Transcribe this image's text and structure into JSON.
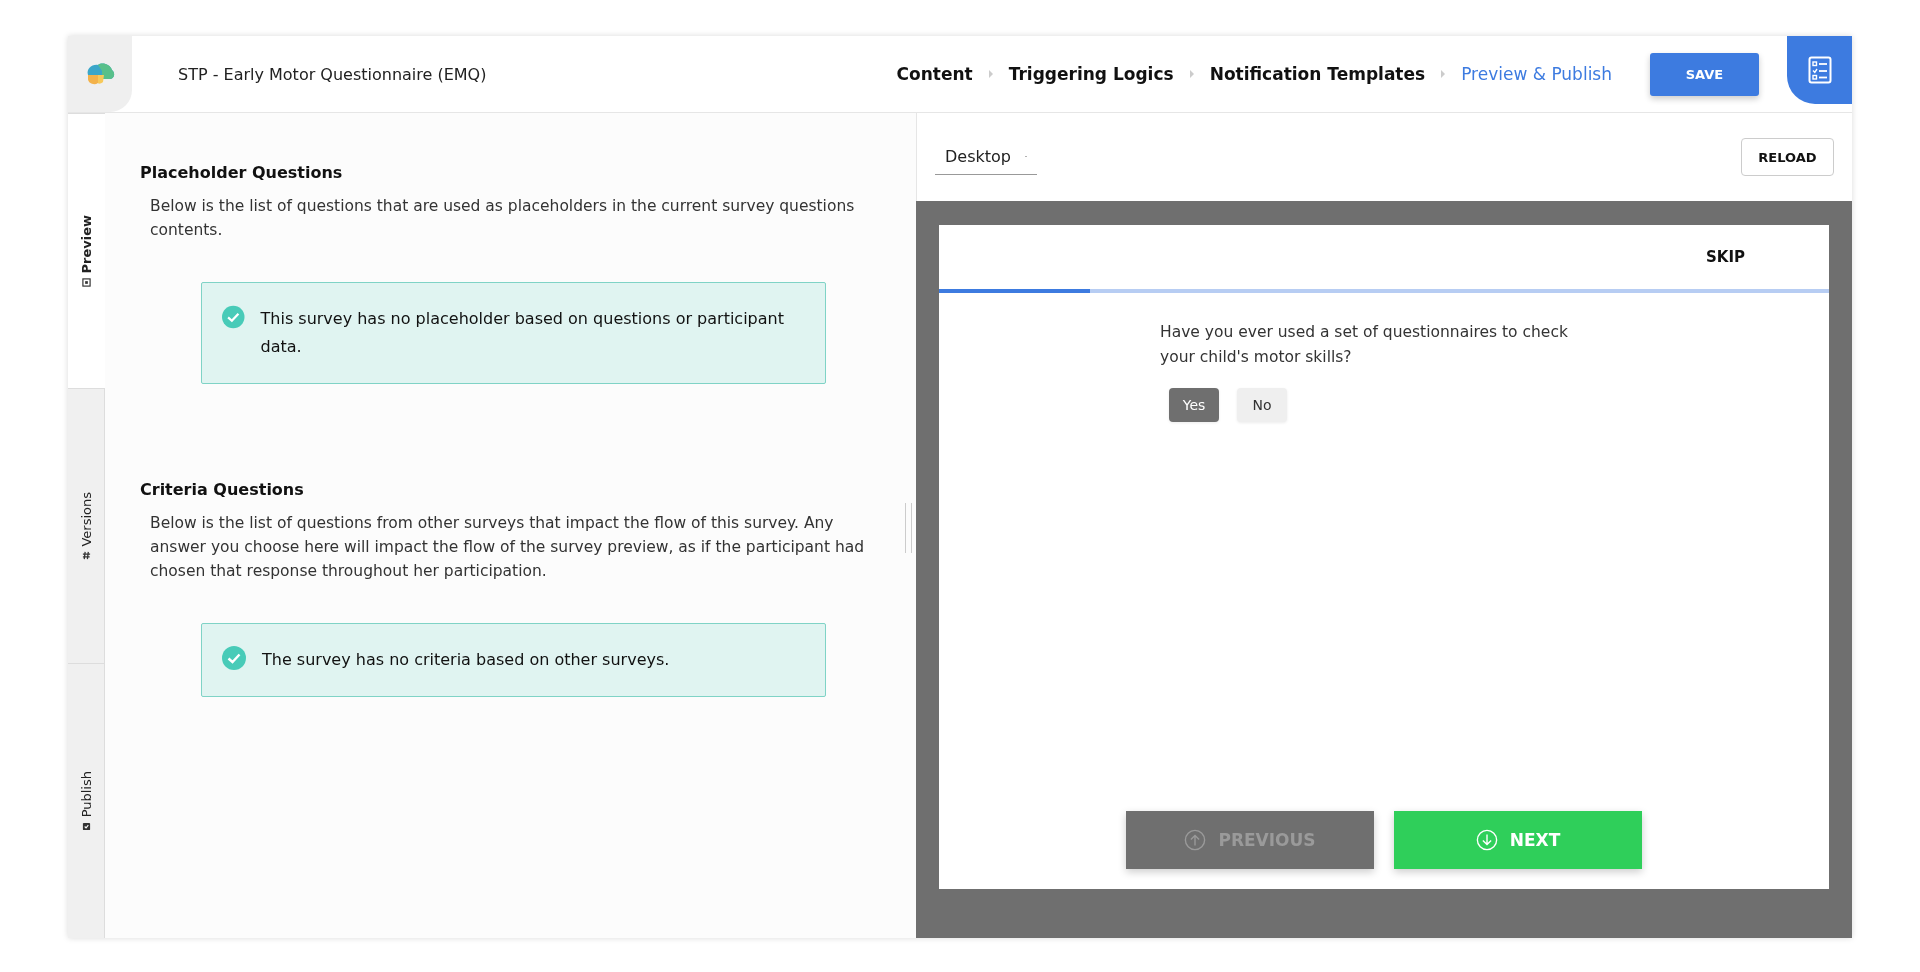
{
  "header": {
    "title": "STP - Early Motor Questionnaire (EMQ)",
    "steps": [
      {
        "label": "Content",
        "selected": false
      },
      {
        "label": "Triggering Logics",
        "selected": false
      },
      {
        "label": "Notification Templates",
        "selected": false
      },
      {
        "label": "Preview & Publish",
        "selected": true
      }
    ],
    "save_button": "SAVE"
  },
  "side_tabs": [
    {
      "label": "Preview",
      "kind": "preview",
      "selected": true
    },
    {
      "label": "Versions",
      "kind": "versions",
      "selected": false
    },
    {
      "label": "Publish",
      "kind": "publish",
      "selected": false
    }
  ],
  "sections": [
    {
      "title": "Placeholder Questions",
      "description": "Below is the list of questions that are used as placeholders in the current survey questions contents.",
      "notice": "This survey has no placeholder based on questions or participant data."
    },
    {
      "title": "Criteria Questions",
      "description": "Below is the list of questions from other surveys that impact the flow of this survey. Any answer you choose here will impact the flow of the survey preview, as if the participant had chosen that response throughout her participation.",
      "notice": "The survey has no criteria based on other surveys."
    }
  ],
  "preview": {
    "device": "Desktop",
    "reload_button": "RELOAD",
    "skip": "SKIP",
    "progress": {
      "level": 0.17
    },
    "question": "Have you ever used a set of questionnaires to check your child's motor skills?",
    "options": [
      {
        "label": "Yes",
        "selected": true
      },
      {
        "label": "No",
        "selected": false
      }
    ],
    "previous_button": {
      "label": "PREVIOUS",
      "disabled": true
    },
    "next_button": {
      "label": "NEXT",
      "disabled": false
    }
  }
}
